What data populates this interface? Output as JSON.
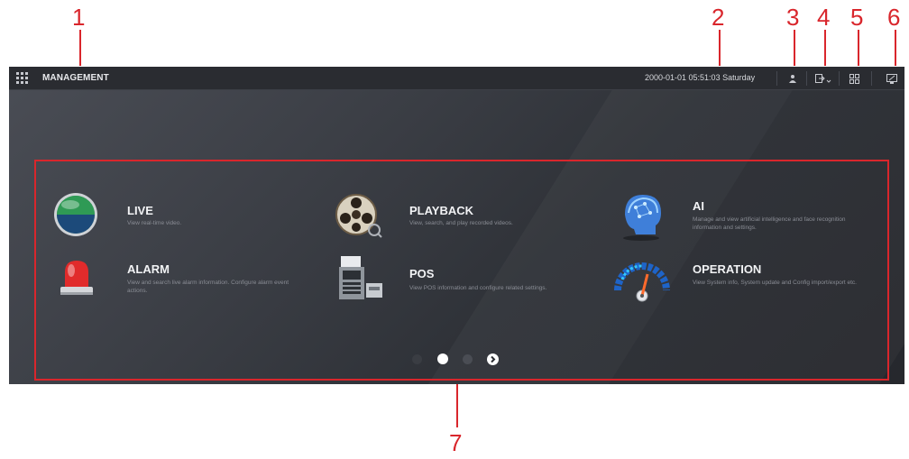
{
  "callouts": [
    "1",
    "2",
    "3",
    "4",
    "5",
    "6",
    "7"
  ],
  "topbar": {
    "title": "MANAGEMENT",
    "datetime": "2000-01-01 05:51:03 Saturday",
    "icons": [
      "grid-menu-icon",
      "user-icon",
      "logout-icon",
      "layout-icon",
      "display-icon"
    ]
  },
  "tiles": [
    {
      "title": "LIVE",
      "desc": "View real-time video.",
      "icon": "live-icon"
    },
    {
      "title": "PLAYBACK",
      "desc": "View, search, and play recorded videos.",
      "icon": "playback-icon"
    },
    {
      "title": "AI",
      "desc": "Manage and view artificial intelligence and face recognition information and settings.",
      "icon": "ai-icon"
    },
    {
      "title": "ALARM",
      "desc": "View and search live alarm information. Configure alarm event actions.",
      "icon": "alarm-icon"
    },
    {
      "title": "POS",
      "desc": "View POS information and configure related settings.",
      "icon": "pos-icon"
    },
    {
      "title": "OPERATION",
      "desc": "View System info, System update and Config import/export etc.",
      "icon": "operation-icon"
    }
  ],
  "pagination": {
    "pages": 3,
    "current": 2
  },
  "colors": {
    "callout": "#d9262c",
    "background": "#2f3238",
    "topbar": "#2a2c31"
  }
}
